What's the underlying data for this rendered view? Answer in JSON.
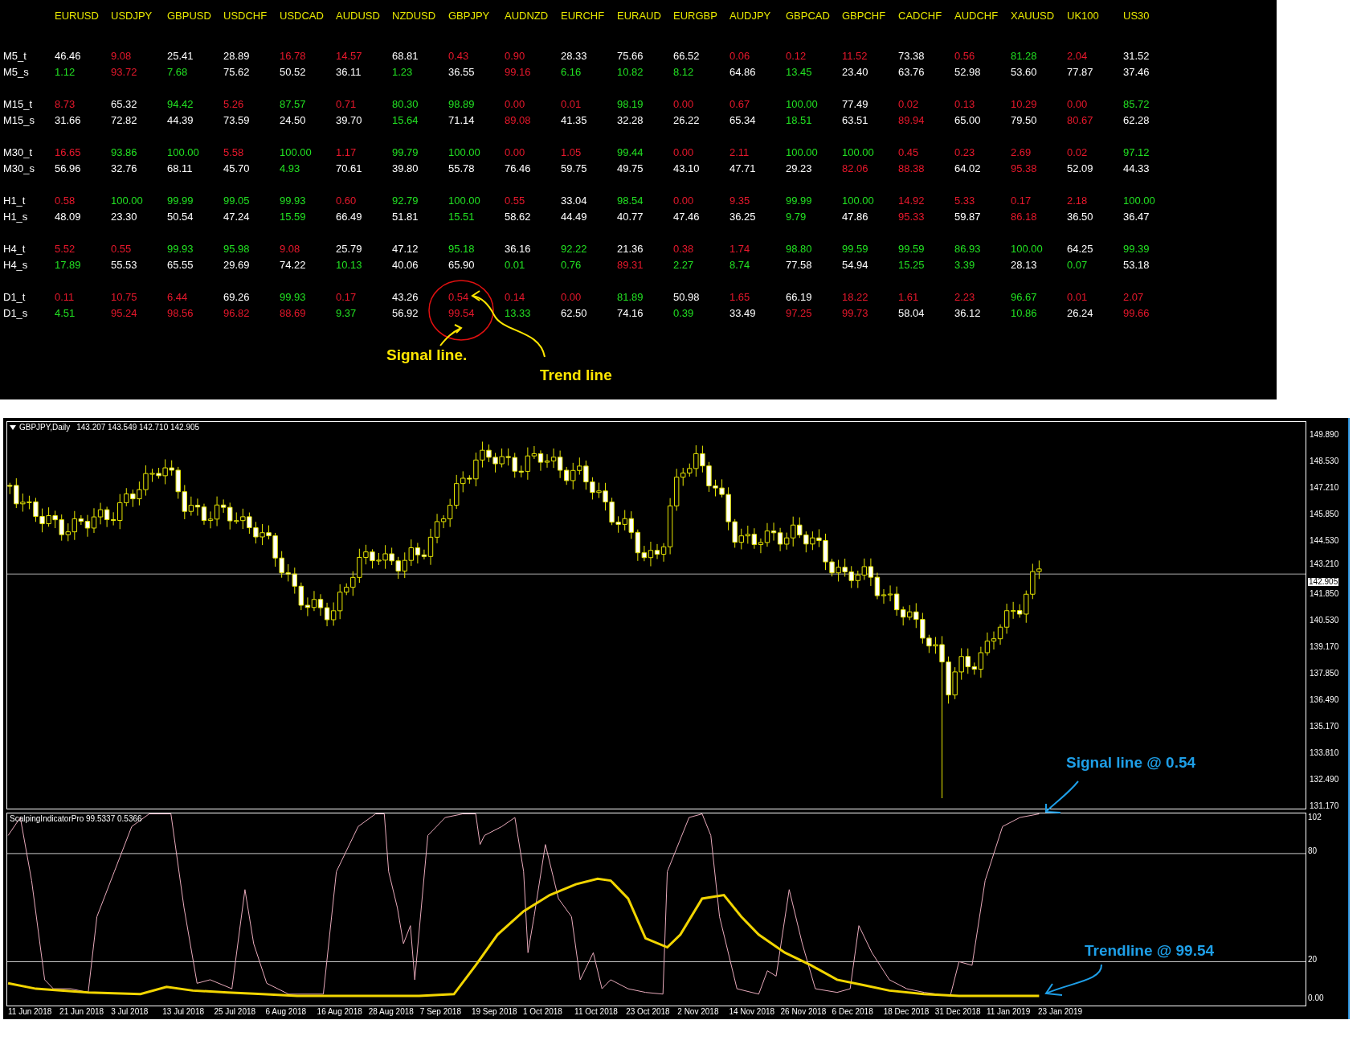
{
  "strength_table": {
    "columns": [
      "EURUSD",
      "USDJPY",
      "GBPUSD",
      "USDCHF",
      "USDCAD",
      "AUDUSD",
      "NZDUSD",
      "GBPJPY",
      "AUDNZD",
      "EURCHF",
      "EURAUD",
      "EURGBP",
      "AUDJPY",
      "GBPCAD",
      "GBPCHF",
      "CADCHF",
      "AUDCHF",
      "XAUUSD",
      "UK100",
      "US30"
    ],
    "rows": [
      {
        "label": "M5_t",
        "cells": [
          {
            "text": "46.46",
            "color": "#ffffff"
          },
          {
            "text": "9.08",
            "color": "#e8182c"
          },
          {
            "text": "25.41",
            "color": "#ffffff"
          },
          {
            "text": "28.89",
            "color": "#ffffff"
          },
          {
            "text": "16.78",
            "color": "#e8182c"
          },
          {
            "text": "14.57",
            "color": "#e8182c"
          },
          {
            "text": "68.81",
            "color": "#ffffff"
          },
          {
            "text": "0.43",
            "color": "#e8182c"
          },
          {
            "text": "0.90",
            "color": "#e8182c"
          },
          {
            "text": "28.33",
            "color": "#ffffff"
          },
          {
            "text": "75.66",
            "color": "#ffffff"
          },
          {
            "text": "66.52",
            "color": "#ffffff"
          },
          {
            "text": "0.06",
            "color": "#e8182c"
          },
          {
            "text": "0.12",
            "color": "#e8182c"
          },
          {
            "text": "11.52",
            "color": "#e8182c"
          },
          {
            "text": "73.38",
            "color": "#ffffff"
          },
          {
            "text": "0.56",
            "color": "#e8182c"
          },
          {
            "text": "81.28",
            "color": "#22e022"
          },
          {
            "text": "2.04",
            "color": "#e8182c"
          },
          {
            "text": "31.52",
            "color": "#ffffff"
          }
        ]
      },
      {
        "label": "M5_s",
        "cells": [
          {
            "text": "1.12",
            "color": "#22e022"
          },
          {
            "text": "93.72",
            "color": "#e8182c"
          },
          {
            "text": "7.68",
            "color": "#22e022"
          },
          {
            "text": "75.62",
            "color": "#ffffff"
          },
          {
            "text": "50.52",
            "color": "#ffffff"
          },
          {
            "text": "36.11",
            "color": "#ffffff"
          },
          {
            "text": "1.23",
            "color": "#22e022"
          },
          {
            "text": "36.55",
            "color": "#ffffff"
          },
          {
            "text": "99.16",
            "color": "#e8182c"
          },
          {
            "text": "6.16",
            "color": "#22e022"
          },
          {
            "text": "10.82",
            "color": "#22e022"
          },
          {
            "text": "8.12",
            "color": "#22e022"
          },
          {
            "text": "64.86",
            "color": "#ffffff"
          },
          {
            "text": "13.45",
            "color": "#22e022"
          },
          {
            "text": "23.40",
            "color": "#ffffff"
          },
          {
            "text": "63.76",
            "color": "#ffffff"
          },
          {
            "text": "52.98",
            "color": "#ffffff"
          },
          {
            "text": "53.60",
            "color": "#ffffff"
          },
          {
            "text": "77.87",
            "color": "#ffffff"
          },
          {
            "text": "37.46",
            "color": "#ffffff"
          }
        ]
      },
      {
        "label": "M15_t",
        "cells": [
          {
            "text": "8.73",
            "color": "#e8182c"
          },
          {
            "text": "65.32",
            "color": "#ffffff"
          },
          {
            "text": "94.42",
            "color": "#22e022"
          },
          {
            "text": "5.26",
            "color": "#e8182c"
          },
          {
            "text": "87.57",
            "color": "#22e022"
          },
          {
            "text": "0.71",
            "color": "#e8182c"
          },
          {
            "text": "80.30",
            "color": "#22e022"
          },
          {
            "text": "98.89",
            "color": "#22e022"
          },
          {
            "text": "0.00",
            "color": "#e8182c"
          },
          {
            "text": "0.01",
            "color": "#e8182c"
          },
          {
            "text": "98.19",
            "color": "#22e022"
          },
          {
            "text": "0.00",
            "color": "#e8182c"
          },
          {
            "text": "0.67",
            "color": "#e8182c"
          },
          {
            "text": "100.00",
            "color": "#22e022"
          },
          {
            "text": "77.49",
            "color": "#ffffff"
          },
          {
            "text": "0.02",
            "color": "#e8182c"
          },
          {
            "text": "0.13",
            "color": "#e8182c"
          },
          {
            "text": "10.29",
            "color": "#e8182c"
          },
          {
            "text": "0.00",
            "color": "#e8182c"
          },
          {
            "text": "85.72",
            "color": "#22e022"
          }
        ]
      },
      {
        "label": "M15_s",
        "cells": [
          {
            "text": "31.66",
            "color": "#ffffff"
          },
          {
            "text": "72.82",
            "color": "#ffffff"
          },
          {
            "text": "44.39",
            "color": "#ffffff"
          },
          {
            "text": "73.59",
            "color": "#ffffff"
          },
          {
            "text": "24.50",
            "color": "#ffffff"
          },
          {
            "text": "39.70",
            "color": "#ffffff"
          },
          {
            "text": "15.64",
            "color": "#22e022"
          },
          {
            "text": "71.14",
            "color": "#ffffff"
          },
          {
            "text": "89.08",
            "color": "#e8182c"
          },
          {
            "text": "41.35",
            "color": "#ffffff"
          },
          {
            "text": "32.28",
            "color": "#ffffff"
          },
          {
            "text": "26.22",
            "color": "#ffffff"
          },
          {
            "text": "65.34",
            "color": "#ffffff"
          },
          {
            "text": "18.51",
            "color": "#22e022"
          },
          {
            "text": "63.51",
            "color": "#ffffff"
          },
          {
            "text": "89.94",
            "color": "#e8182c"
          },
          {
            "text": "65.00",
            "color": "#ffffff"
          },
          {
            "text": "79.50",
            "color": "#ffffff"
          },
          {
            "text": "80.67",
            "color": "#e8182c"
          },
          {
            "text": "62.28",
            "color": "#ffffff"
          }
        ]
      },
      {
        "label": "M30_t",
        "cells": [
          {
            "text": "16.65",
            "color": "#e8182c"
          },
          {
            "text": "93.86",
            "color": "#22e022"
          },
          {
            "text": "100.00",
            "color": "#22e022"
          },
          {
            "text": "5.58",
            "color": "#e8182c"
          },
          {
            "text": "100.00",
            "color": "#22e022"
          },
          {
            "text": "1.17",
            "color": "#e8182c"
          },
          {
            "text": "99.79",
            "color": "#22e022"
          },
          {
            "text": "100.00",
            "color": "#22e022"
          },
          {
            "text": "0.00",
            "color": "#e8182c"
          },
          {
            "text": "1.05",
            "color": "#e8182c"
          },
          {
            "text": "99.44",
            "color": "#22e022"
          },
          {
            "text": "0.00",
            "color": "#e8182c"
          },
          {
            "text": "2.11",
            "color": "#e8182c"
          },
          {
            "text": "100.00",
            "color": "#22e022"
          },
          {
            "text": "100.00",
            "color": "#22e022"
          },
          {
            "text": "0.45",
            "color": "#e8182c"
          },
          {
            "text": "0.23",
            "color": "#e8182c"
          },
          {
            "text": "2.69",
            "color": "#e8182c"
          },
          {
            "text": "0.02",
            "color": "#e8182c"
          },
          {
            "text": "97.12",
            "color": "#22e022"
          }
        ]
      },
      {
        "label": "M30_s",
        "cells": [
          {
            "text": "56.96",
            "color": "#ffffff"
          },
          {
            "text": "32.76",
            "color": "#ffffff"
          },
          {
            "text": "68.11",
            "color": "#ffffff"
          },
          {
            "text": "45.70",
            "color": "#ffffff"
          },
          {
            "text": "4.93",
            "color": "#22e022"
          },
          {
            "text": "70.61",
            "color": "#ffffff"
          },
          {
            "text": "39.80",
            "color": "#ffffff"
          },
          {
            "text": "55.78",
            "color": "#ffffff"
          },
          {
            "text": "76.46",
            "color": "#ffffff"
          },
          {
            "text": "59.75",
            "color": "#ffffff"
          },
          {
            "text": "49.75",
            "color": "#ffffff"
          },
          {
            "text": "43.10",
            "color": "#ffffff"
          },
          {
            "text": "47.71",
            "color": "#ffffff"
          },
          {
            "text": "29.23",
            "color": "#ffffff"
          },
          {
            "text": "82.06",
            "color": "#e8182c"
          },
          {
            "text": "88.38",
            "color": "#e8182c"
          },
          {
            "text": "64.02",
            "color": "#ffffff"
          },
          {
            "text": "95.38",
            "color": "#e8182c"
          },
          {
            "text": "52.09",
            "color": "#ffffff"
          },
          {
            "text": "44.33",
            "color": "#ffffff"
          }
        ]
      },
      {
        "label": "H1_t",
        "cells": [
          {
            "text": "0.58",
            "color": "#e8182c"
          },
          {
            "text": "100.00",
            "color": "#22e022"
          },
          {
            "text": "99.99",
            "color": "#22e022"
          },
          {
            "text": "99.05",
            "color": "#22e022"
          },
          {
            "text": "99.93",
            "color": "#22e022"
          },
          {
            "text": "0.60",
            "color": "#e8182c"
          },
          {
            "text": "92.79",
            "color": "#22e022"
          },
          {
            "text": "100.00",
            "color": "#22e022"
          },
          {
            "text": "0.55",
            "color": "#e8182c"
          },
          {
            "text": "33.04",
            "color": "#ffffff"
          },
          {
            "text": "98.54",
            "color": "#22e022"
          },
          {
            "text": "0.00",
            "color": "#e8182c"
          },
          {
            "text": "9.35",
            "color": "#e8182c"
          },
          {
            "text": "99.99",
            "color": "#22e022"
          },
          {
            "text": "100.00",
            "color": "#22e022"
          },
          {
            "text": "14.92",
            "color": "#e8182c"
          },
          {
            "text": "5.33",
            "color": "#e8182c"
          },
          {
            "text": "0.17",
            "color": "#e8182c"
          },
          {
            "text": "2.18",
            "color": "#e8182c"
          },
          {
            "text": "100.00",
            "color": "#22e022"
          }
        ]
      },
      {
        "label": "H1_s",
        "cells": [
          {
            "text": "48.09",
            "color": "#ffffff"
          },
          {
            "text": "23.30",
            "color": "#ffffff"
          },
          {
            "text": "50.54",
            "color": "#ffffff"
          },
          {
            "text": "47.24",
            "color": "#ffffff"
          },
          {
            "text": "15.59",
            "color": "#22e022"
          },
          {
            "text": "66.49",
            "color": "#ffffff"
          },
          {
            "text": "51.81",
            "color": "#ffffff"
          },
          {
            "text": "15.51",
            "color": "#22e022"
          },
          {
            "text": "58.62",
            "color": "#ffffff"
          },
          {
            "text": "44.49",
            "color": "#ffffff"
          },
          {
            "text": "40.77",
            "color": "#ffffff"
          },
          {
            "text": "47.46",
            "color": "#ffffff"
          },
          {
            "text": "36.25",
            "color": "#ffffff"
          },
          {
            "text": "9.79",
            "color": "#22e022"
          },
          {
            "text": "47.86",
            "color": "#ffffff"
          },
          {
            "text": "95.33",
            "color": "#e8182c"
          },
          {
            "text": "59.87",
            "color": "#ffffff"
          },
          {
            "text": "86.18",
            "color": "#e8182c"
          },
          {
            "text": "36.50",
            "color": "#ffffff"
          },
          {
            "text": "36.47",
            "color": "#ffffff"
          }
        ]
      },
      {
        "label": "H4_t",
        "cells": [
          {
            "text": "5.52",
            "color": "#e8182c"
          },
          {
            "text": "0.55",
            "color": "#e8182c"
          },
          {
            "text": "99.93",
            "color": "#22e022"
          },
          {
            "text": "95.98",
            "color": "#22e022"
          },
          {
            "text": "9.08",
            "color": "#e8182c"
          },
          {
            "text": "25.79",
            "color": "#ffffff"
          },
          {
            "text": "47.12",
            "color": "#ffffff"
          },
          {
            "text": "95.18",
            "color": "#22e022"
          },
          {
            "text": "36.16",
            "color": "#ffffff"
          },
          {
            "text": "92.22",
            "color": "#22e022"
          },
          {
            "text": "21.36",
            "color": "#ffffff"
          },
          {
            "text": "0.38",
            "color": "#e8182c"
          },
          {
            "text": "1.74",
            "color": "#e8182c"
          },
          {
            "text": "98.80",
            "color": "#22e022"
          },
          {
            "text": "99.59",
            "color": "#22e022"
          },
          {
            "text": "99.59",
            "color": "#22e022"
          },
          {
            "text": "86.93",
            "color": "#22e022"
          },
          {
            "text": "100.00",
            "color": "#22e022"
          },
          {
            "text": "64.25",
            "color": "#ffffff"
          },
          {
            "text": "99.39",
            "color": "#22e022"
          }
        ]
      },
      {
        "label": "H4_s",
        "cells": [
          {
            "text": "17.89",
            "color": "#22e022"
          },
          {
            "text": "55.53",
            "color": "#ffffff"
          },
          {
            "text": "65.55",
            "color": "#ffffff"
          },
          {
            "text": "29.69",
            "color": "#ffffff"
          },
          {
            "text": "74.22",
            "color": "#ffffff"
          },
          {
            "text": "10.13",
            "color": "#22e022"
          },
          {
            "text": "40.06",
            "color": "#ffffff"
          },
          {
            "text": "65.90",
            "color": "#ffffff"
          },
          {
            "text": "0.01",
            "color": "#22e022"
          },
          {
            "text": "0.76",
            "color": "#22e022"
          },
          {
            "text": "89.31",
            "color": "#e8182c"
          },
          {
            "text": "2.27",
            "color": "#22e022"
          },
          {
            "text": "8.74",
            "color": "#22e022"
          },
          {
            "text": "77.58",
            "color": "#ffffff"
          },
          {
            "text": "54.94",
            "color": "#ffffff"
          },
          {
            "text": "15.25",
            "color": "#22e022"
          },
          {
            "text": "3.39",
            "color": "#22e022"
          },
          {
            "text": "28.13",
            "color": "#ffffff"
          },
          {
            "text": "0.07",
            "color": "#22e022"
          },
          {
            "text": "53.18",
            "color": "#ffffff"
          }
        ]
      },
      {
        "label": "D1_t",
        "cells": [
          {
            "text": "0.11",
            "color": "#e8182c"
          },
          {
            "text": "10.75",
            "color": "#e8182c"
          },
          {
            "text": "6.44",
            "color": "#e8182c"
          },
          {
            "text": "69.26",
            "color": "#ffffff"
          },
          {
            "text": "99.93",
            "color": "#22e022"
          },
          {
            "text": "0.17",
            "color": "#e8182c"
          },
          {
            "text": "43.26",
            "color": "#ffffff"
          },
          {
            "text": "0.54",
            "color": "#e8182c"
          },
          {
            "text": "0.14",
            "color": "#e8182c"
          },
          {
            "text": "0.00",
            "color": "#e8182c"
          },
          {
            "text": "81.89",
            "color": "#22e022"
          },
          {
            "text": "50.98",
            "color": "#ffffff"
          },
          {
            "text": "1.65",
            "color": "#e8182c"
          },
          {
            "text": "66.19",
            "color": "#ffffff"
          },
          {
            "text": "18.22",
            "color": "#e8182c"
          },
          {
            "text": "1.61",
            "color": "#e8182c"
          },
          {
            "text": "2.23",
            "color": "#e8182c"
          },
          {
            "text": "96.67",
            "color": "#22e022"
          },
          {
            "text": "0.01",
            "color": "#e8182c"
          },
          {
            "text": "2.07",
            "color": "#e8182c"
          }
        ]
      },
      {
        "label": "D1_s",
        "cells": [
          {
            "text": "4.51",
            "color": "#22e022"
          },
          {
            "text": "95.24",
            "color": "#e8182c"
          },
          {
            "text": "98.56",
            "color": "#e8182c"
          },
          {
            "text": "96.82",
            "color": "#e8182c"
          },
          {
            "text": "88.69",
            "color": "#e8182c"
          },
          {
            "text": "9.37",
            "color": "#22e022"
          },
          {
            "text": "56.92",
            "color": "#ffffff"
          },
          {
            "text": "99.54",
            "color": "#e8182c"
          },
          {
            "text": "13.33",
            "color": "#22e022"
          },
          {
            "text": "62.50",
            "color": "#ffffff"
          },
          {
            "text": "74.16",
            "color": "#ffffff"
          },
          {
            "text": "0.39",
            "color": "#22e022"
          },
          {
            "text": "33.49",
            "color": "#ffffff"
          },
          {
            "text": "97.25",
            "color": "#e8182c"
          },
          {
            "text": "99.73",
            "color": "#e8182c"
          },
          {
            "text": "58.04",
            "color": "#ffffff"
          },
          {
            "text": "36.12",
            "color": "#ffffff"
          },
          {
            "text": "10.86",
            "color": "#22e022"
          },
          {
            "text": "26.24",
            "color": "#ffffff"
          },
          {
            "text": "99.66",
            "color": "#e8182c"
          }
        ]
      }
    ]
  },
  "table_annotations": {
    "signal_label": "Signal line.",
    "trend_label": "Trend line"
  },
  "chart": {
    "title": "GBPJPY,Daily",
    "ohlc": "143.207 143.549 142.710 142.905",
    "price_axis": [
      "149.890",
      "148.530",
      "147.210",
      "145.850",
      "144.530",
      "143.210",
      "141.850",
      "140.530",
      "139.170",
      "137.850",
      "136.490",
      "135.170",
      "133.810",
      "132.490",
      "131.170"
    ],
    "current_price": "142.905",
    "indicator": {
      "title": "ScalpingIndicatorPro 99.5337 0.5366",
      "axis": [
        "102",
        "80",
        "20",
        "0.00"
      ]
    },
    "date_axis": [
      "11 Jun 2018",
      "21 Jun 2018",
      "3 Jul 2018",
      "13 Jul 2018",
      "25 Jul 2018",
      "6 Aug 2018",
      "16 Aug 2018",
      "28 Aug 2018",
      "7 Sep 2018",
      "19 Sep 2018",
      "1 Oct 2018",
      "11 Oct 2018",
      "23 Oct 2018",
      "2 Nov 2018",
      "14 Nov 2018",
      "26 Nov 2018",
      "6 Dec 2018",
      "18 Dec 2018",
      "31 Dec 2018",
      "11 Jan 2019",
      "23 Jan 2019"
    ],
    "annotations": {
      "signal_label": "Signal line @ 0.54",
      "trend_label": "Trendline @ 99.54"
    }
  }
}
